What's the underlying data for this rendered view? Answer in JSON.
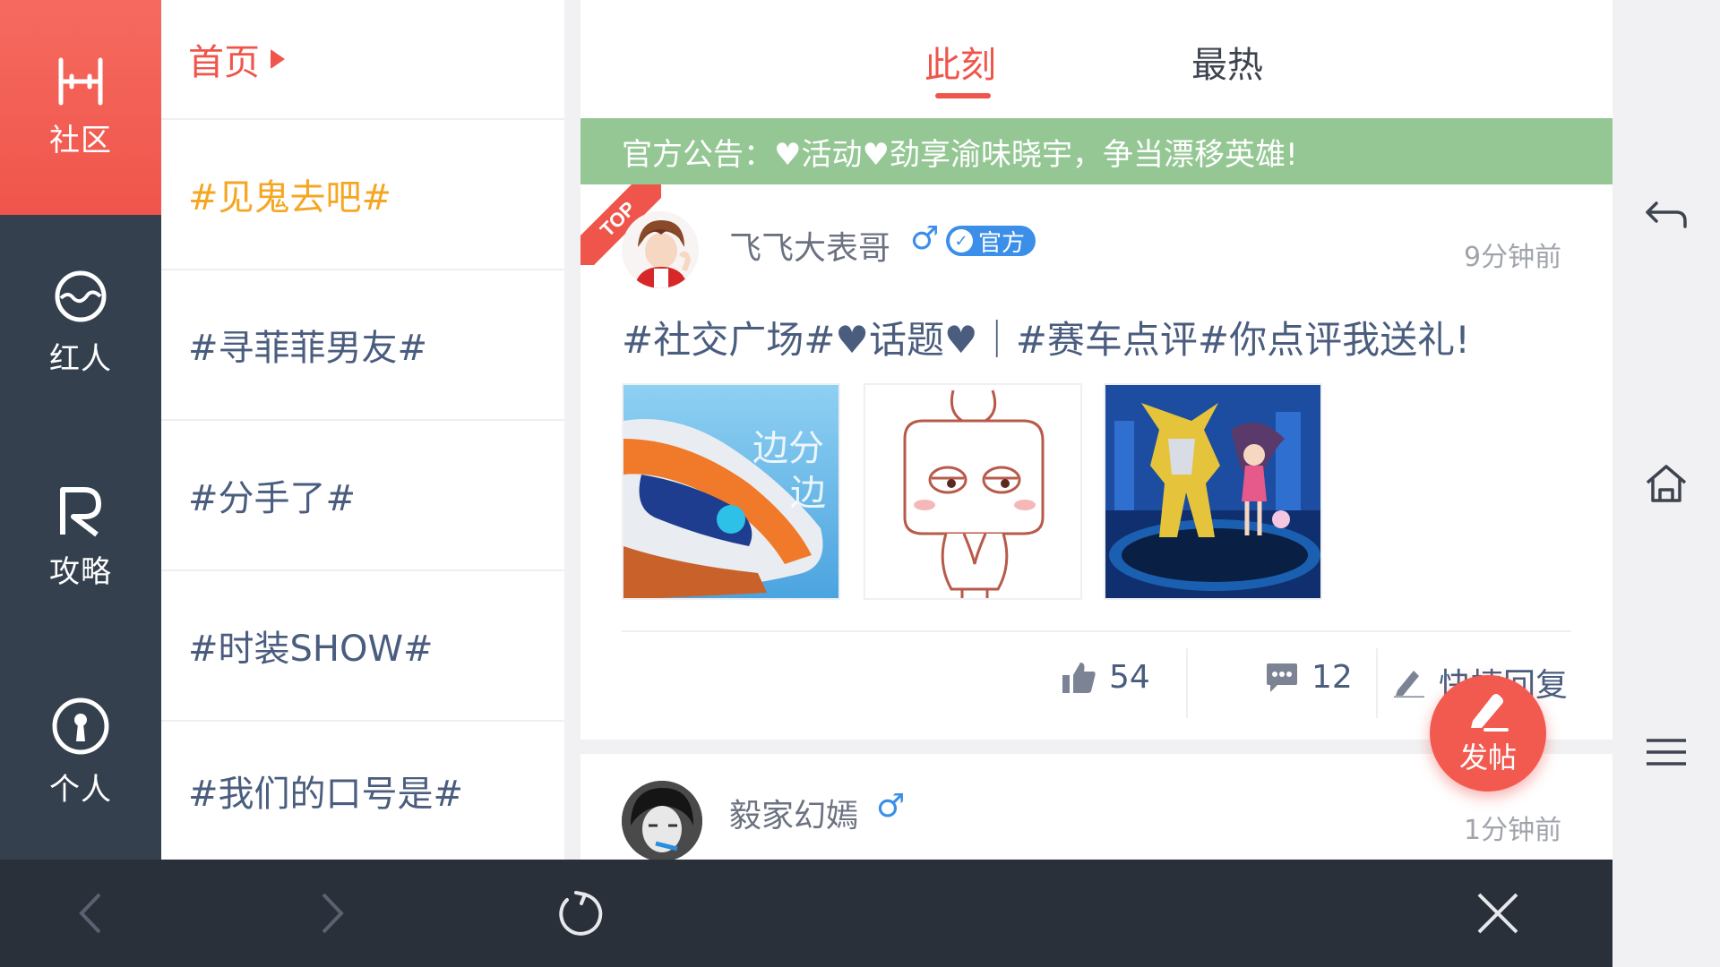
{
  "nav": {
    "items": [
      {
        "label": "社区",
        "icon": "community-icon"
      },
      {
        "label": "红人",
        "icon": "celebrity-icon"
      },
      {
        "label": "攻略",
        "icon": "guide-icon"
      },
      {
        "label": "个人",
        "icon": "profile-icon"
      }
    ]
  },
  "topics": {
    "home": "首页",
    "items": [
      "#见鬼去吧#",
      "#寻菲菲男友#",
      "#分手了#",
      "#时装SHOW#",
      "#我们的口号是#"
    ]
  },
  "tabs": {
    "now": "此刻",
    "hot": "最热"
  },
  "notice": "官方公告：♥活动♥劲享渝味晓宇，争当漂移英雄!",
  "post1": {
    "badge": "TOP",
    "author": "飞飞大表哥",
    "gender_symbol": "♂",
    "official_label": "官方",
    "time": "9分钟前",
    "title": "#社交广场#♥话题♥｜#赛车点评#你点评我送礼!",
    "image1_text_a": "边分",
    "image1_text_b": "边",
    "likes": "54",
    "comments": "12",
    "quick_reply": "快捷回复"
  },
  "post2": {
    "author": "毅家幻嫣",
    "gender_symbol": "♂",
    "time": "1分钟前"
  },
  "fab": {
    "label": "发帖"
  },
  "colors": {
    "accent": "#f0554b",
    "nav_bg": "#35404f",
    "notice_bg": "#95c795",
    "topic_text": "#4a5d7e",
    "hot_topic": "#f5a623",
    "male_blue": "#3b8fe8"
  }
}
